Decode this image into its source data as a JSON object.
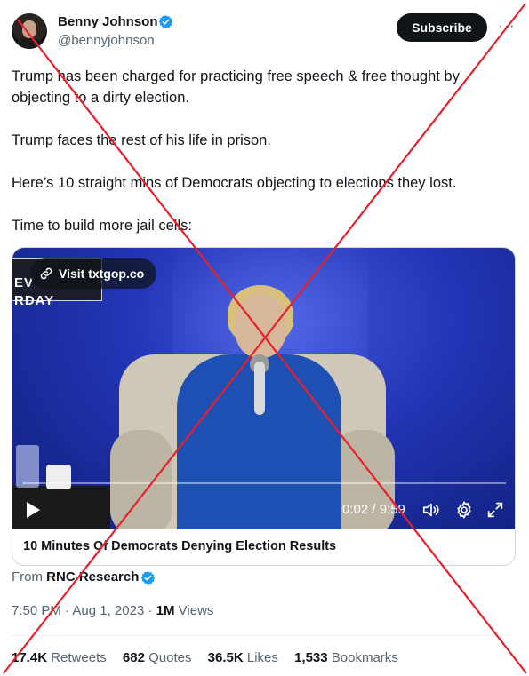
{
  "author": {
    "name": "Benny Johnson",
    "handle": "@bennyjohnson",
    "subscribe_label": "Subscribe",
    "more_label": "···",
    "verified_color": "#1d9bf0"
  },
  "tweet": {
    "paragraphs": [
      "Trump has been charged for practicing free speech & free thought by objecting to a dirty election.",
      "Trump faces the rest of his life in prison.",
      "Here’s 10 straight mins of Democrats objecting to elections they lost.",
      "Time to build more jail cells:"
    ]
  },
  "video": {
    "visit_label": "Visit txtgop.co",
    "banner_line1": "EV",
    "banner_line2": "RDAY",
    "time": "0:02 / 9:59",
    "progress": 0.004,
    "card_title": "10 Minutes Of Democrats Denying Election Results"
  },
  "source": {
    "from_label": "From",
    "name": "RNC Research"
  },
  "meta": {
    "time": "7:50 PM",
    "date": "Aug 1, 2023",
    "views_count": "1M",
    "views_label": "Views"
  },
  "stats": {
    "retweets_count": "17.4K",
    "retweets_label": "Retweets",
    "quotes_count": "682",
    "quotes_label": "Quotes",
    "likes_count": "36.5K",
    "likes_label": "Likes",
    "bookmarks_count": "1,533",
    "bookmarks_label": "Bookmarks"
  },
  "overlay": {
    "cross_color": "#e8202a"
  }
}
